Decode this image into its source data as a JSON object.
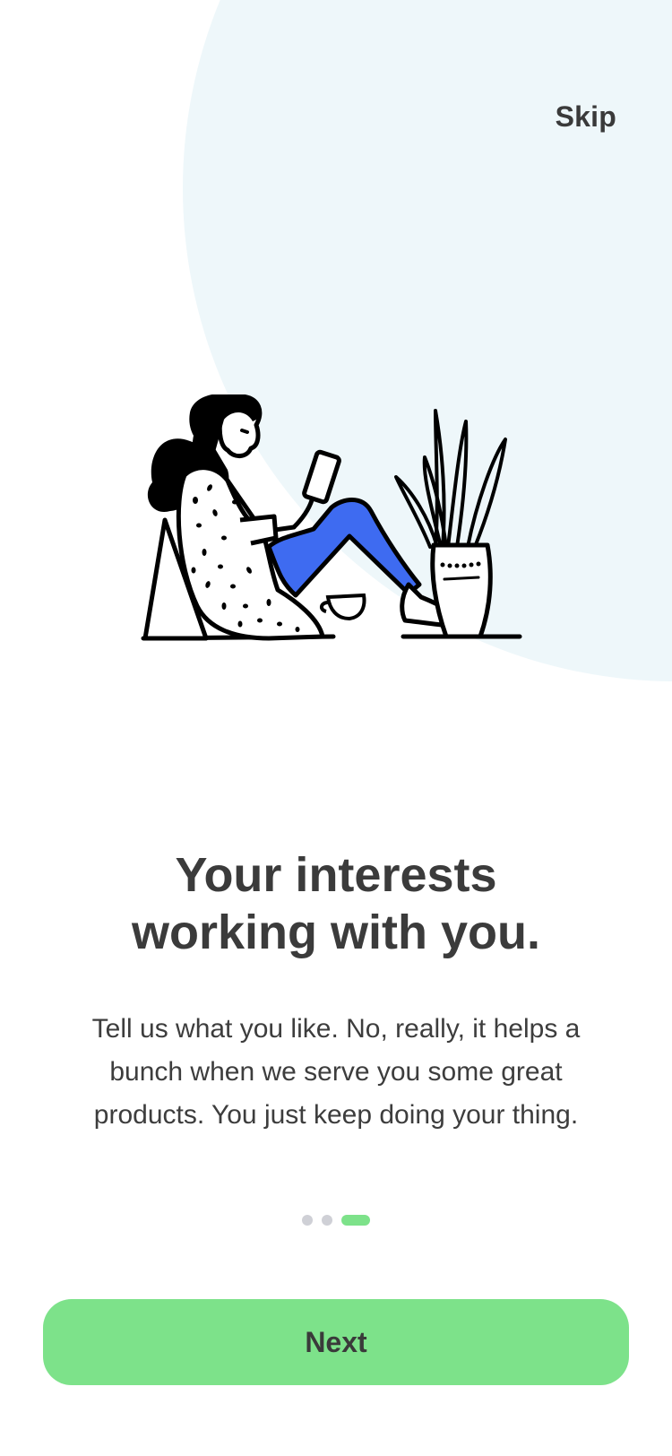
{
  "header": {
    "skip_label": "Skip"
  },
  "illustration": {
    "name": "woman-reading-icon",
    "accent_color": "#3e6bf1"
  },
  "content": {
    "title_line1": "Your interests",
    "title_line2": "working with you.",
    "description": "Tell us what you like. No, really, it helps a bunch when we serve you some great products. You just keep doing your thing."
  },
  "pagination": {
    "current": 3,
    "total": 3,
    "active_color": "#7de28a",
    "inactive_color": "#cfd0d6"
  },
  "footer": {
    "next_label": "Next",
    "button_color": "#7de28a"
  },
  "colors": {
    "background": "#ffffff",
    "circle": "#eef7fa",
    "text": "#3a3a3a"
  }
}
